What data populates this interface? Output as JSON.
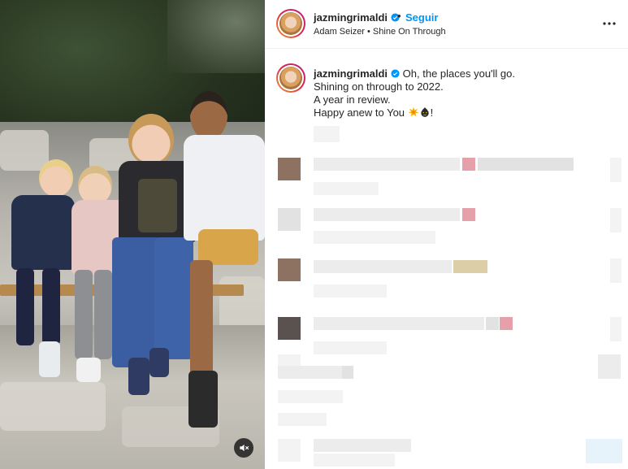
{
  "post": {
    "username": "jazmingrimaldi",
    "separator": "•",
    "follow_label": "Seguir",
    "audio_label": "Adam Seizer • Shine On Through"
  },
  "caption": {
    "username": "jazmingrimaldi",
    "lines": [
      "Oh, the places you'll go.",
      "Shining on through to 2022.",
      "A year in review.",
      "Happy anew to You"
    ],
    "end_text": "!"
  },
  "icons": {
    "verified": "verified-badge-icon",
    "more": "more-options-icon",
    "mute": "audio-muted-icon",
    "emoji_1": "sparkle-burst-emoji",
    "emoji_2": "party-face-emoji"
  },
  "colors": {
    "follow": "#0095f6",
    "verified": "#0095f6",
    "text": "#262626"
  }
}
